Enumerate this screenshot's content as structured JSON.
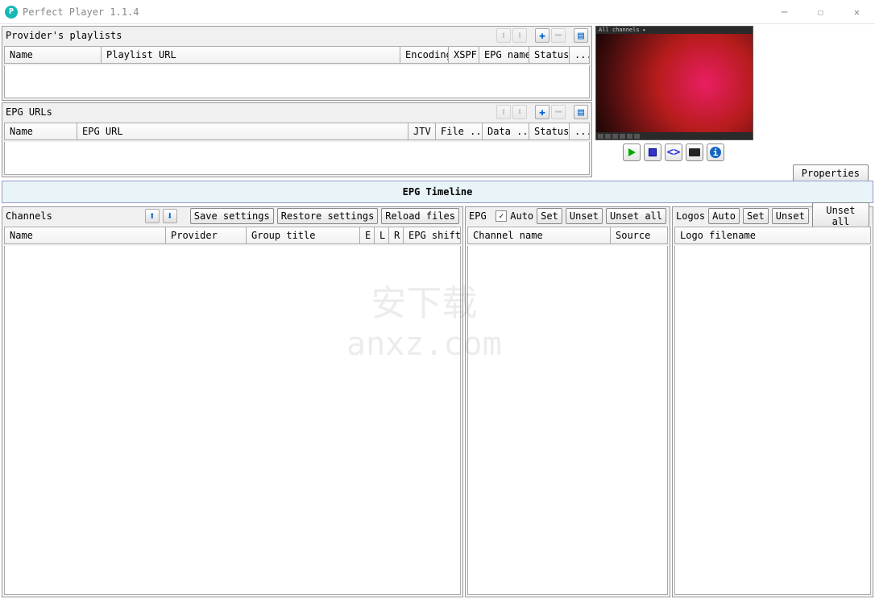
{
  "title": "Perfect Player 1.1.4",
  "playlists": {
    "label": "Provider's playlists",
    "cols": {
      "name": "Name",
      "url": "Playlist URL",
      "encoding": "Encoding",
      "xspf": "XSPF",
      "epgname": "EPG name",
      "status": "Status",
      "dots": "..."
    }
  },
  "epgurls": {
    "label": "EPG URLs",
    "cols": {
      "name": "Name",
      "url": "EPG URL",
      "jtv": "JTV",
      "file": "File ...",
      "data": "Data ...",
      "status": "Status",
      "dots": "..."
    }
  },
  "preview_topbar": "All channels ▸",
  "properties_btn": "Properties",
  "timeline": "EPG Timeline",
  "channels": {
    "label": "Channels",
    "save": "Save settings",
    "restore": "Restore settings",
    "reload": "Reload files",
    "cols": {
      "name": "Name",
      "provider": "Provider",
      "group": "Group title",
      "e": "E",
      "l": "L",
      "r": "R",
      "shift": "EPG shift"
    }
  },
  "epg": {
    "label": "EPG",
    "auto": "Auto",
    "set": "Set",
    "unset": "Unset",
    "unsetall": "Unset all",
    "cols": {
      "channel": "Channel name",
      "source": "Source"
    }
  },
  "logos": {
    "label": "Logos",
    "auto": "Auto",
    "set": "Set",
    "unset": "Unset",
    "unsetall": "Unset all",
    "cols": {
      "filename": "Logo filename"
    }
  },
  "watermark": {
    "big": "安下载",
    "small": "anxz.com"
  }
}
